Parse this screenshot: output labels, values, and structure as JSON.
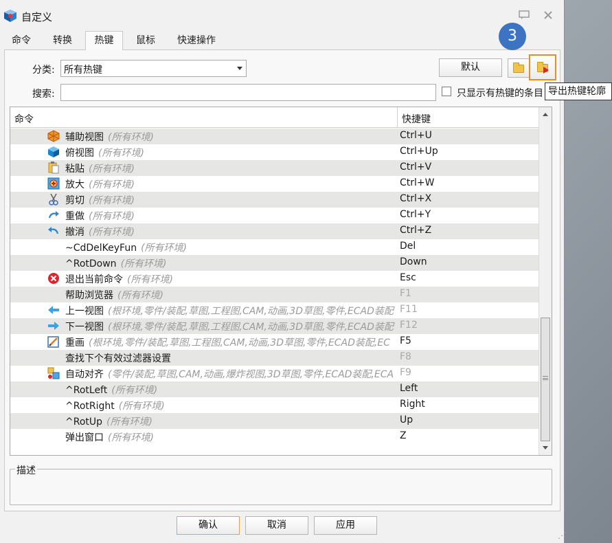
{
  "window": {
    "title": "自定义",
    "help_icon": "chat-bubble-icon",
    "close_icon": "close-icon"
  },
  "tabs": [
    {
      "label": "命令"
    },
    {
      "label": "转换"
    },
    {
      "label": "热键",
      "active": true
    },
    {
      "label": "鼠标"
    },
    {
      "label": "快速操作"
    }
  ],
  "filter": {
    "category_label": "分类:",
    "category_value": "所有热键",
    "search_label": "搜索:",
    "search_value": "",
    "only_hotkeys_label": "只显示有热键的条目",
    "only_hotkeys_checked": false,
    "default_button": "默认"
  },
  "annotation_badge": "3",
  "tooltip": "导出热键轮廓",
  "grid": {
    "col_command": "命令",
    "col_shortcut": "快捷键",
    "rows": [
      {
        "name": "辅助视图",
        "env": "(所有环境)",
        "key": "Ctrl+U",
        "icon": "cube-orange-icon",
        "key_dim": false
      },
      {
        "name": "俯视图",
        "env": "(所有环境)",
        "key": "Ctrl+Up",
        "icon": "cube-blue-icon",
        "key_dim": false
      },
      {
        "name": "粘贴",
        "env": "(所有环境)",
        "key": "Ctrl+V",
        "icon": "paste-icon",
        "key_dim": false
      },
      {
        "name": "放大",
        "env": "(所有环境)",
        "key": "Ctrl+W",
        "icon": "zoom-in-icon",
        "key_dim": false
      },
      {
        "name": "剪切",
        "env": "(所有环境)",
        "key": "Ctrl+X",
        "icon": "scissors-icon",
        "key_dim": false
      },
      {
        "name": "重做",
        "env": "(所有环境)",
        "key": "Ctrl+Y",
        "icon": "redo-icon",
        "key_dim": false
      },
      {
        "name": "撤消",
        "env": "(所有环境)",
        "key": "Ctrl+Z",
        "icon": "undo-icon",
        "key_dim": false
      },
      {
        "name": "~CdDelKeyFun",
        "env": "(所有环境)",
        "key": "Del",
        "icon": "",
        "key_dim": false
      },
      {
        "name": "^RotDown",
        "env": "(所有环境)",
        "key": "Down",
        "icon": "",
        "key_dim": false
      },
      {
        "name": "退出当前命令",
        "env": "(所有环境)",
        "key": "Esc",
        "icon": "cancel-icon",
        "key_dim": false
      },
      {
        "name": "帮助浏览器",
        "env": "(所有环境)",
        "key": "F1",
        "icon": "",
        "key_dim": true
      },
      {
        "name": "上一视图",
        "env": "(根环境,零件/装配,草图,工程图,CAM,动画,3D草图,零件,ECAD装配",
        "key": "F11",
        "icon": "arrow-left-icon",
        "key_dim": true
      },
      {
        "name": "下一视图",
        "env": "(根环境,零件/装配,草图,工程图,CAM,动画,3D草图,零件,ECAD装配",
        "key": "F12",
        "icon": "arrow-right-icon",
        "key_dim": true
      },
      {
        "name": "重画",
        "env": "(根环境,零件/装配,草图,工程图,CAM,动画,3D草图,零件,ECAD装配,EC",
        "key": "F5",
        "icon": "redraw-icon",
        "key_dim": false
      },
      {
        "name": "查找下个有效过滤器设置",
        "env": "",
        "key": "F8",
        "icon": "",
        "key_dim": true
      },
      {
        "name": "自动对齐",
        "env": "(零件/装配,草图,CAM,动画,爆炸视图,3D草图,零件,ECAD装配,ECA",
        "key": "F9",
        "icon": "auto-align-icon",
        "key_dim": true
      },
      {
        "name": "^RotLeft",
        "env": "(所有环境)",
        "key": "Left",
        "icon": "",
        "key_dim": false
      },
      {
        "name": "^RotRight",
        "env": "(所有环境)",
        "key": "Right",
        "icon": "",
        "key_dim": false
      },
      {
        "name": "^RotUp",
        "env": "(所有环境)",
        "key": "Up",
        "icon": "",
        "key_dim": false
      },
      {
        "name": "弹出窗口",
        "env": "(所有环境)",
        "key": "Z",
        "icon": "",
        "key_dim": false
      }
    ]
  },
  "description_label": "描述",
  "footer": {
    "ok": "确认",
    "cancel": "取消",
    "apply": "应用"
  },
  "colors": {
    "accent_orange": "#f08a18",
    "badge_blue": "#3c73c2",
    "alt_row": "#e6e6e4"
  }
}
